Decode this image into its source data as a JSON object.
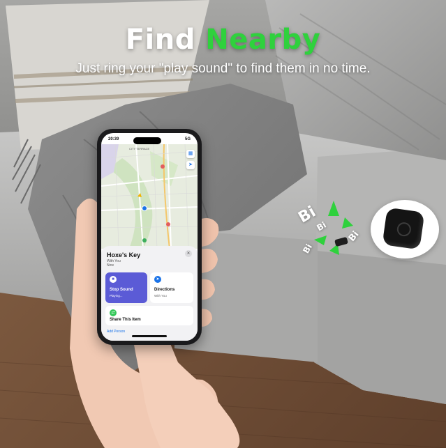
{
  "headline": {
    "part1": "Find",
    "part2": "Nearby",
    "accent_color": "#2fd13d"
  },
  "subheadline": "Just ring your \"play sound\" to find them in no time.",
  "phone": {
    "status_time": "20:39",
    "status_signal": "5G",
    "map_label": "CITY TERRACE",
    "item_name": "Hoxe's Key",
    "item_status": "With You",
    "item_time": "Now",
    "actions": [
      {
        "label": "Stop Sound",
        "sub": "Playing...",
        "icon": "stop-icon"
      },
      {
        "label": "Directions",
        "sub": "With You",
        "icon": "directions-icon"
      },
      {
        "label": "Share This Item",
        "sub": "",
        "icon": "share-icon"
      }
    ],
    "add_person": "Add Person"
  },
  "sound_text": [
    "Bi",
    "Bi",
    "Bi",
    "Bi"
  ]
}
